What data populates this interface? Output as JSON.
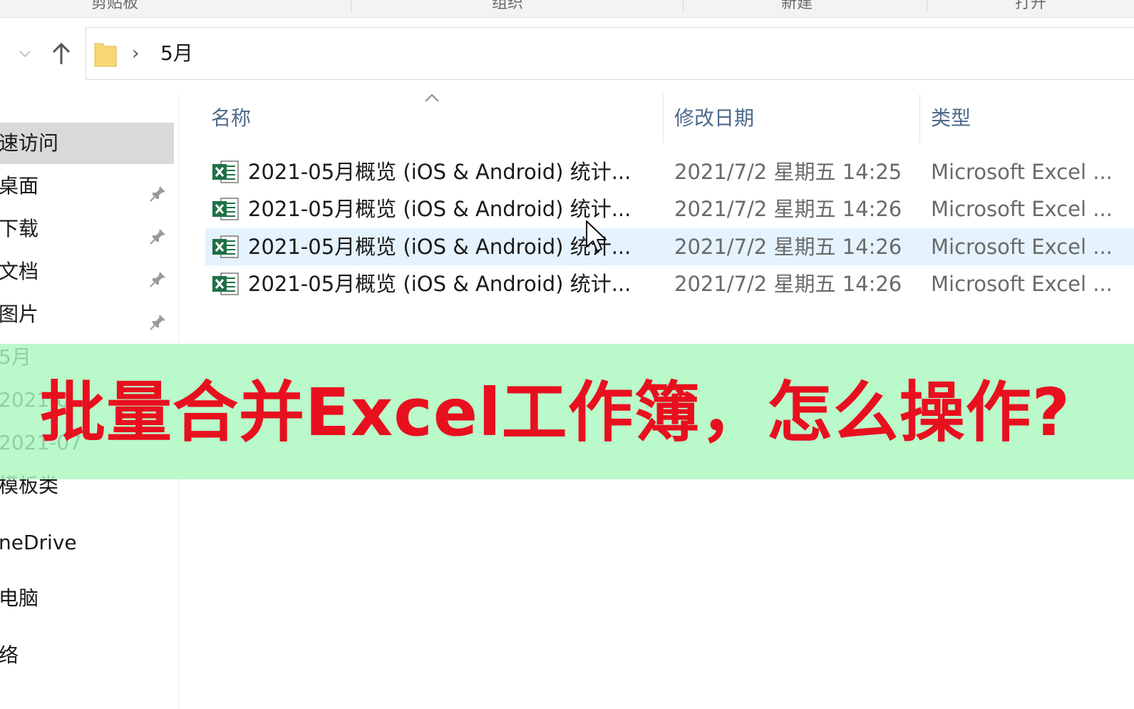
{
  "ribbon": {
    "groups": [
      "剪贴板",
      "组织",
      "新建",
      "打开"
    ]
  },
  "navigation": {
    "breadcrumb": "5月",
    "chevron": "›"
  },
  "sidebar": {
    "items": [
      {
        "label": "速访问",
        "pinned": false,
        "selected": true
      },
      {
        "label": "桌面",
        "pinned": true
      },
      {
        "label": "下载",
        "pinned": true
      },
      {
        "label": "文档",
        "pinned": true
      },
      {
        "label": "图片",
        "pinned": true
      },
      {
        "label": "5月",
        "pinned": false
      },
      {
        "label": "2021-0",
        "pinned": false
      },
      {
        "label": "2021-07",
        "pinned": false
      },
      {
        "label": "模板类",
        "pinned": false
      },
      {
        "label": "neDrive",
        "pinned": false
      },
      {
        "label": "电脑",
        "pinned": false
      },
      {
        "label": "络",
        "pinned": false
      }
    ]
  },
  "columns": {
    "name": "名称",
    "modified": "修改日期",
    "type": "类型"
  },
  "files": [
    {
      "name": "2021-05月概览 (iOS & Android) 统计...",
      "modified": "2021/7/2 星期五 14:25",
      "type": "Microsoft Excel ...",
      "icon": "excel-icon"
    },
    {
      "name": "2021-05月概览 (iOS & Android) 统计...",
      "modified": "2021/7/2 星期五 14:26",
      "type": "Microsoft Excel ...",
      "icon": "excel-icon"
    },
    {
      "name": "2021-05月概览 (iOS & Android) 统计...",
      "modified": "2021/7/2 星期五 14:26",
      "type": "Microsoft Excel ...",
      "icon": "excel-icon",
      "hovered": true
    },
    {
      "name": "2021-05月概览 (iOS & Android) 统计...",
      "modified": "2021/7/2 星期五 14:26",
      "type": "Microsoft Excel ...",
      "icon": "excel-icon"
    }
  ],
  "overlay": {
    "caption": "批量合并Excel工作簿，怎么操作?",
    "text_color": "#e8101f",
    "background_color": "#aaf8be"
  },
  "colors": {
    "hover_row": "#e5f3ff",
    "selected_nav": "#d9d9d9",
    "excel_green": "#1e7145"
  }
}
